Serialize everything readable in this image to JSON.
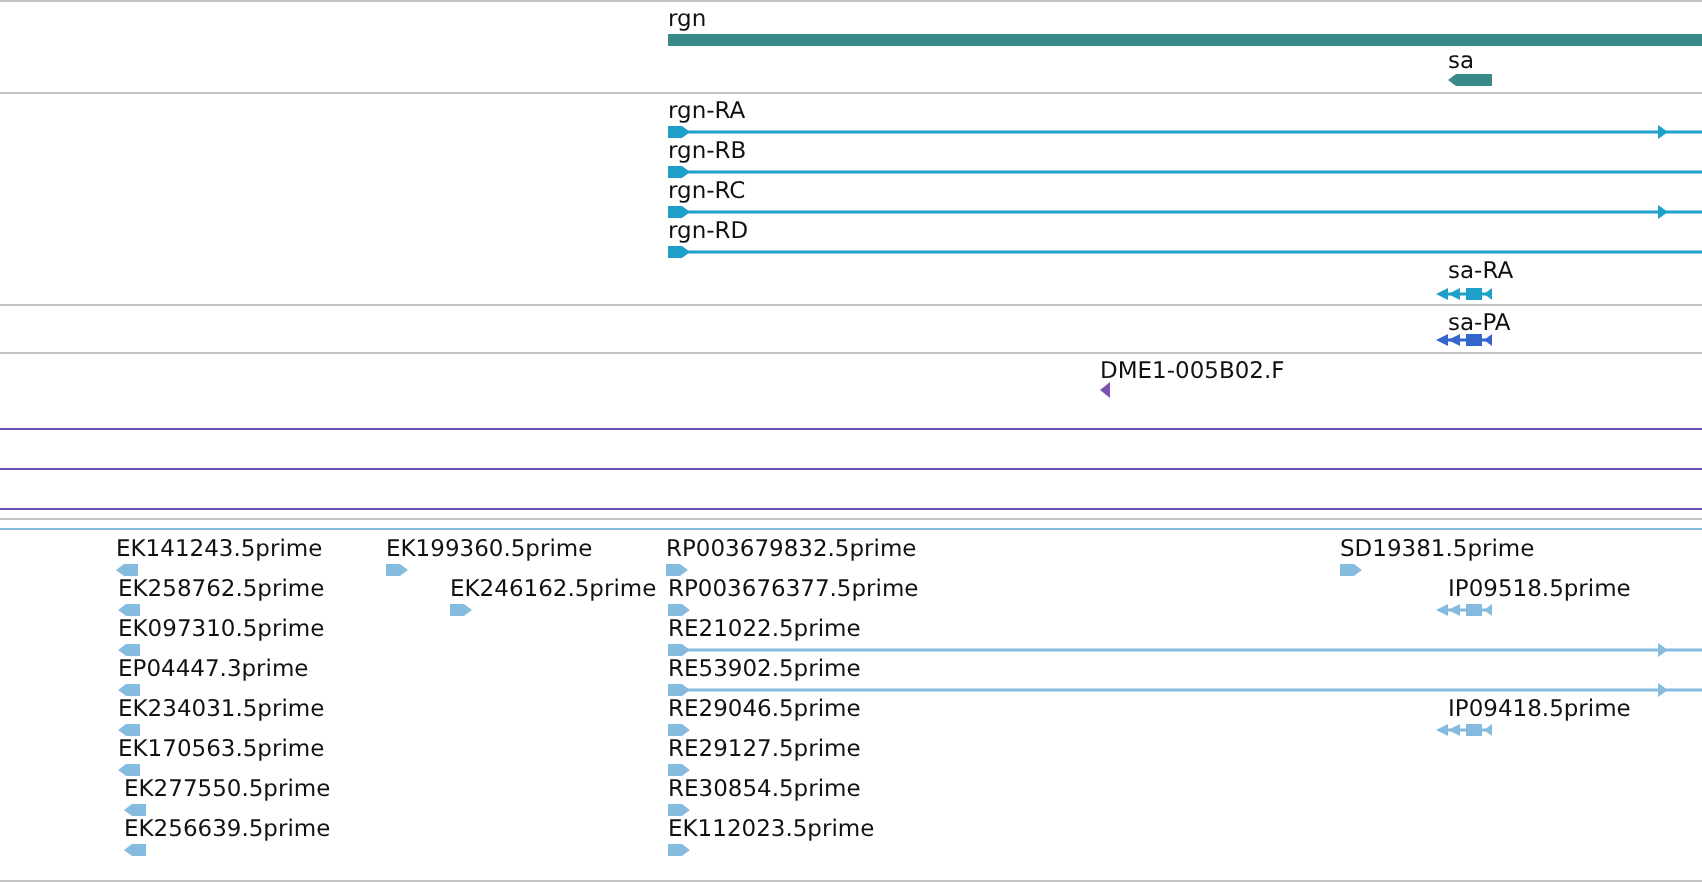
{
  "tracks": [
    {
      "color": "#3a8a8a",
      "features": [
        {
          "label": "rgn",
          "kind": "gene"
        },
        {
          "label": "sa",
          "kind": "gene",
          "reverse": true
        }
      ]
    },
    {
      "color": "#1ea1c8",
      "features": [
        {
          "label": "rgn-RA",
          "kind": "transcript",
          "reverse": false
        },
        {
          "label": "rgn-RB",
          "kind": "transcript",
          "reverse": false
        },
        {
          "label": "rgn-RC",
          "kind": "transcript",
          "reverse": false
        },
        {
          "label": "rgn-RD",
          "kind": "transcript",
          "reverse": false
        },
        {
          "label": "sa-RA",
          "kind": "transcript",
          "reverse": true
        }
      ]
    },
    {
      "color": "#3466cc",
      "features": [
        {
          "label": "sa-PA",
          "kind": "transcript",
          "reverse": true
        }
      ]
    },
    {
      "color": "#7a55b0",
      "features": [
        {
          "label": "DME1-005B02.F",
          "kind": "read",
          "reverse": true
        }
      ]
    },
    {
      "color": "#86bbe0",
      "features": [
        {
          "label": "EK141243.5prime",
          "kind": "read",
          "reverse": true
        },
        {
          "label": "EK199360.5prime",
          "kind": "read",
          "reverse": false
        },
        {
          "label": "RP003679832.5prime",
          "kind": "read",
          "reverse": false
        },
        {
          "label": "SD19381.5prime",
          "kind": "read",
          "reverse": false
        },
        {
          "label": "EK258762.5prime",
          "kind": "read",
          "reverse": true
        },
        {
          "label": "EK246162.5prime",
          "kind": "read",
          "reverse": false
        },
        {
          "label": "RP003676377.5prime",
          "kind": "read",
          "reverse": false
        },
        {
          "label": "IP09518.5prime",
          "kind": "transcript",
          "reverse": true
        },
        {
          "label": "EK097310.5prime",
          "kind": "read",
          "reverse": true
        },
        {
          "label": "RE21022.5prime",
          "kind": "transcript",
          "reverse": false
        },
        {
          "label": "EP04447.3prime",
          "kind": "read",
          "reverse": true
        },
        {
          "label": "RE53902.5prime",
          "kind": "transcript",
          "reverse": false
        },
        {
          "label": "EK234031.5prime",
          "kind": "read",
          "reverse": true
        },
        {
          "label": "RE29046.5prime",
          "kind": "read",
          "reverse": false
        },
        {
          "label": "IP09418.5prime",
          "kind": "transcript",
          "reverse": true
        },
        {
          "label": "EK170563.5prime",
          "kind": "read",
          "reverse": true
        },
        {
          "label": "RE29127.5prime",
          "kind": "read",
          "reverse": false
        },
        {
          "label": "EK277550.5prime",
          "kind": "read",
          "reverse": true
        },
        {
          "label": "RE30854.5prime",
          "kind": "read",
          "reverse": false
        },
        {
          "label": "EK256639.5prime",
          "kind": "read",
          "reverse": true
        },
        {
          "label": "EK112023.5prime",
          "kind": "read",
          "reverse": false
        }
      ]
    }
  ]
}
